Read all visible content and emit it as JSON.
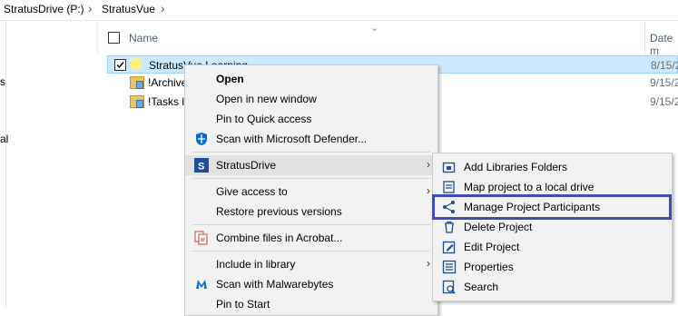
{
  "breadcrumb": {
    "drive": "StratusDrive (P:)",
    "folder": "StratusVue"
  },
  "nav": {
    "frag1": "s",
    "frag2": "al"
  },
  "columns": {
    "name": "Name",
    "date": "Date m"
  },
  "rows": [
    {
      "name": "StratusVue Learning",
      "date": "8/15/2"
    },
    {
      "name": "!Archive",
      "date": "9/15/2"
    },
    {
      "name": "!Tasks l",
      "date": "9/15/2"
    }
  ],
  "context_menu": {
    "open": "Open",
    "open_new_window": "Open in new window",
    "pin_quick_access": "Pin to Quick access",
    "scan_defender": "Scan with Microsoft Defender...",
    "stratusdrive": "StratusDrive",
    "give_access": "Give access to",
    "restore_versions": "Restore previous versions",
    "combine_acrobat": "Combine files in Acrobat...",
    "include_library": "Include in library",
    "scan_malwarebytes": "Scan with Malwarebytes",
    "pin_start": "Pin to Start"
  },
  "submenu": {
    "add_libraries": "Add Libraries Folders",
    "map_project": "Map project to a local drive",
    "manage_participants": "Manage Project Participants",
    "delete_project": "Delete Project",
    "edit_project": "Edit Project",
    "properties": "Properties",
    "search": "Search"
  },
  "colors": {
    "highlight_border": "#3f4bb9",
    "selection": "#cce8ff",
    "menu_bg": "#f2f2f2",
    "submenu_icon": "#1e4e8c"
  }
}
